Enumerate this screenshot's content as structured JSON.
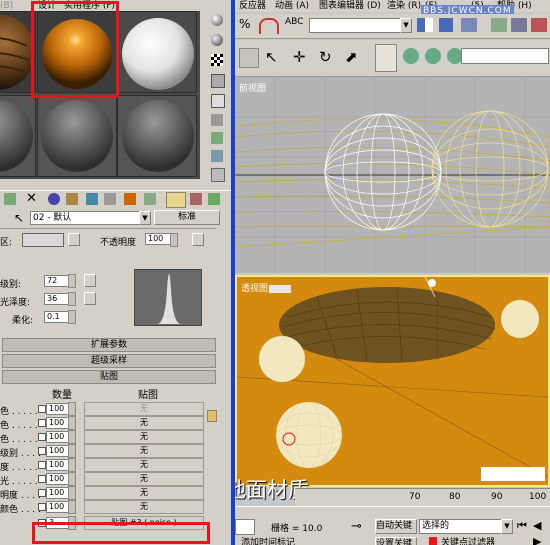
{
  "menu_left": {
    "items": [
      "设计",
      "实用程序 (F)"
    ],
    "ghost": "(B)"
  },
  "menu_right": {
    "items": [
      "反应器",
      "动画 (A)",
      "图表编辑器 (D)",
      "渲染 (R)",
      "(F)",
      "(5)",
      "帮助 (H)"
    ],
    "watermark": "BBS.JCWCN.COM"
  },
  "material": {
    "name": "02 - 默认",
    "type_label": "标准",
    "opacity_label": "不透明度",
    "opacity_value": "100",
    "color_label": "区:",
    "level_label": "级别:",
    "level_value": "72",
    "gloss_label": "光泽度:",
    "gloss_value": "36",
    "soften_label": "柔化:",
    "soften_value": "0.1"
  },
  "rollouts": {
    "extended": "扩展参数",
    "supersampling": "超级采样",
    "maps": "贴图"
  },
  "maps": {
    "col_amount": "数量",
    "col_map": "贴图",
    "rows": [
      {
        "label": "色 . . . . .",
        "amount": "100",
        "map": "无",
        "faded": true
      },
      {
        "label": "色 . . . . .",
        "amount": "100",
        "map": "无",
        "faded": false
      },
      {
        "label": "色 . . . . .",
        "amount": "100",
        "map": "无",
        "faded": false
      },
      {
        "label": "级别 . . . .",
        "amount": "100",
        "map": "无",
        "faded": false
      },
      {
        "label": "度 . . . . .",
        "amount": "100",
        "map": "无",
        "faded": false
      },
      {
        "label": "光 . . . . .",
        "amount": "100",
        "map": "无",
        "faded": false
      },
      {
        "label": "明度 . . . .",
        "amount": "100",
        "map": "无",
        "faded": false
      },
      {
        "label": "颜色 . . . .",
        "amount": "100",
        "map": "无",
        "faded": false
      }
    ],
    "bump_amount": "3",
    "bump_map": "贴图 #3 ( noise )"
  },
  "viewports": {
    "front_label": "前视图",
    "persp_label": "透视图"
  },
  "caption": "这是地面材质",
  "status": {
    "grid_label": "栅格 = 10.0",
    "auto_key": "自动关键点",
    "set_key": "设置关键点",
    "selected": "选择的",
    "key_filter": "关键点过滤器",
    "add_time_tag": "添加时间标记",
    "timeline_ticks": [
      "70",
      "80",
      "90",
      "100"
    ]
  },
  "colors": {
    "accent_red": "#e8141c",
    "divider_blue": "#1b3fcf",
    "perspective_bg": "#d48a0e",
    "wire_yellow": "#e8d27a"
  }
}
